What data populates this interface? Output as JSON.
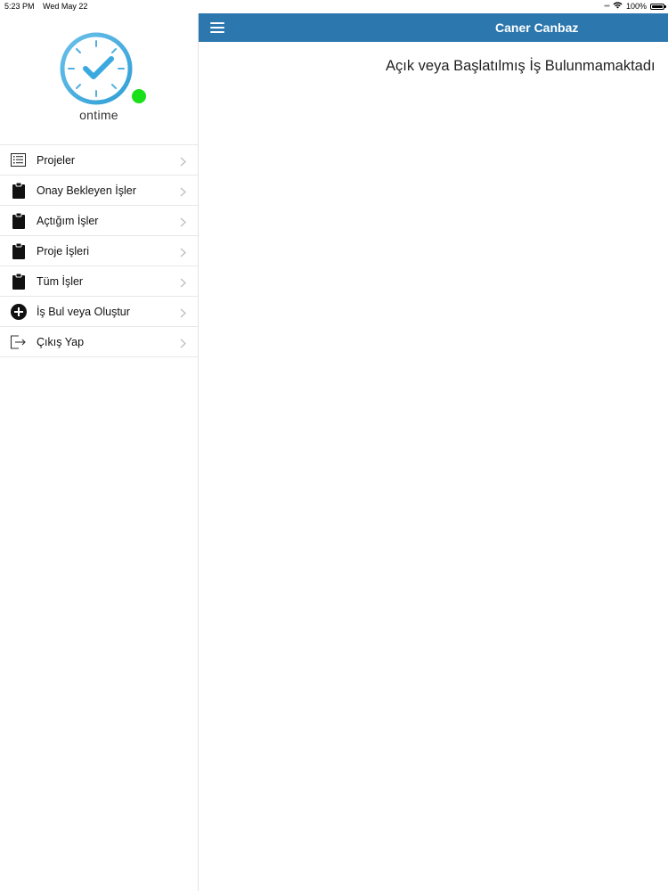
{
  "status_bar": {
    "time": "5:23 PM",
    "date": "Wed May 22",
    "battery_percent": "100%",
    "battery_level": 1.0,
    "wifi_icon": "wifi-icon",
    "battery_icon": "battery-icon"
  },
  "sidebar": {
    "logo_text": "ontime",
    "logo_icon": "clock-check-icon",
    "online_status_color": "#19e019",
    "items": [
      {
        "label": "Projeler",
        "icon": "list-icon"
      },
      {
        "label": "Onay Bekleyen İşler",
        "icon": "clipboard-icon"
      },
      {
        "label": "Açtığım İşler",
        "icon": "clipboard-icon"
      },
      {
        "label": "Proje İşleri",
        "icon": "clipboard-icon"
      },
      {
        "label": "Tüm İşler",
        "icon": "clipboard-icon"
      },
      {
        "label": "İş Bul veya Oluştur",
        "icon": "plus-circle-icon"
      },
      {
        "label": "Çıkış Yap",
        "icon": "logout-icon"
      }
    ]
  },
  "header": {
    "title": "Caner Canbaz",
    "menu_icon": "hamburger-icon",
    "background_color": "#2b77ae"
  },
  "main": {
    "empty_message": "Açık veya Başlatılmış İş Bulunmamaktadı"
  }
}
